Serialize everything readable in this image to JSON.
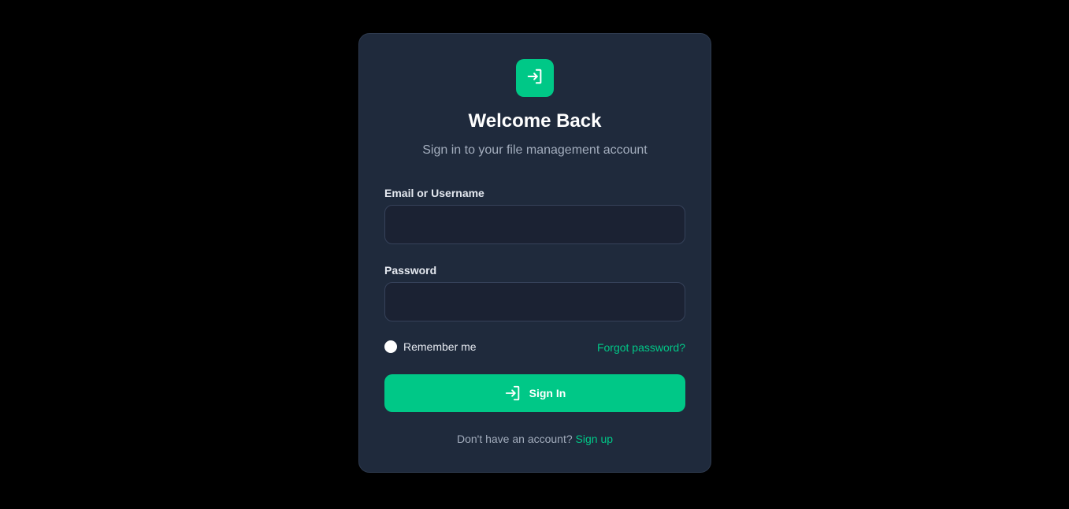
{
  "colors": {
    "accent": "#00c887",
    "card_bg": "#1f2a3c",
    "page_bg": "#000000"
  },
  "logo": {
    "icon": "sign-in-icon"
  },
  "header": {
    "title": "Welcome Back",
    "subtitle": "Sign in to your file management account"
  },
  "form": {
    "email_label": "Email or Username",
    "email_value": "",
    "email_placeholder": "",
    "password_label": "Password",
    "password_value": "",
    "password_placeholder": "",
    "remember_label": "Remember me",
    "forgot_label": "Forgot password?",
    "submit_label": "Sign In",
    "submit_icon": "sign-in-icon"
  },
  "footer": {
    "prompt": "Don't have an account?",
    "signup_label": "Sign up"
  }
}
